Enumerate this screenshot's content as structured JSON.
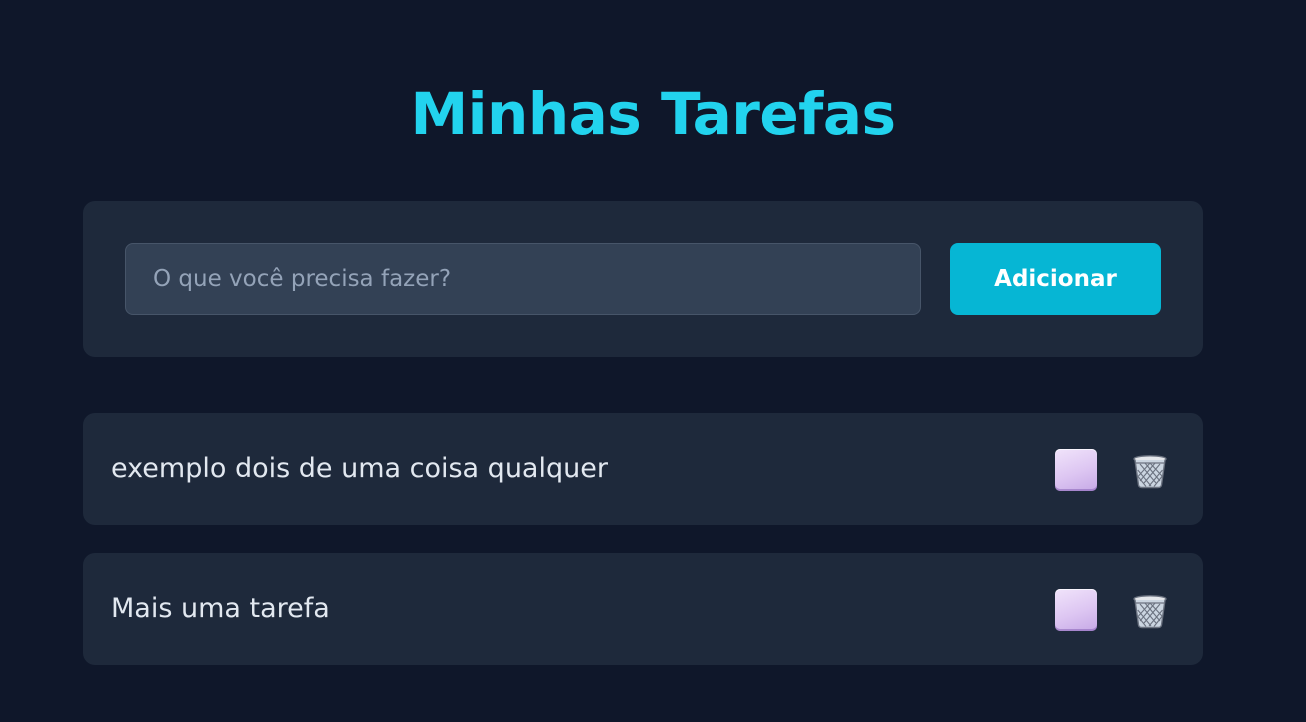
{
  "header": {
    "title": "Minhas Tarefas"
  },
  "form": {
    "input_value": "",
    "input_placeholder": "O que você precisa fazer?",
    "add_label": "Adicionar"
  },
  "tasks": [
    {
      "text": "exemplo dois de uma coisa qualquer",
      "completed": false,
      "check_icon": "checkbox-icon",
      "delete_icon": "trash-icon"
    },
    {
      "text": "Mais uma tarefa",
      "completed": false,
      "check_icon": "checkbox-icon",
      "delete_icon": "trash-icon"
    }
  ],
  "colors": {
    "background": "#0f172a",
    "card": "#1e293b",
    "accent": "#22d3ee",
    "button": "#06b6d4",
    "input": "#334155"
  }
}
